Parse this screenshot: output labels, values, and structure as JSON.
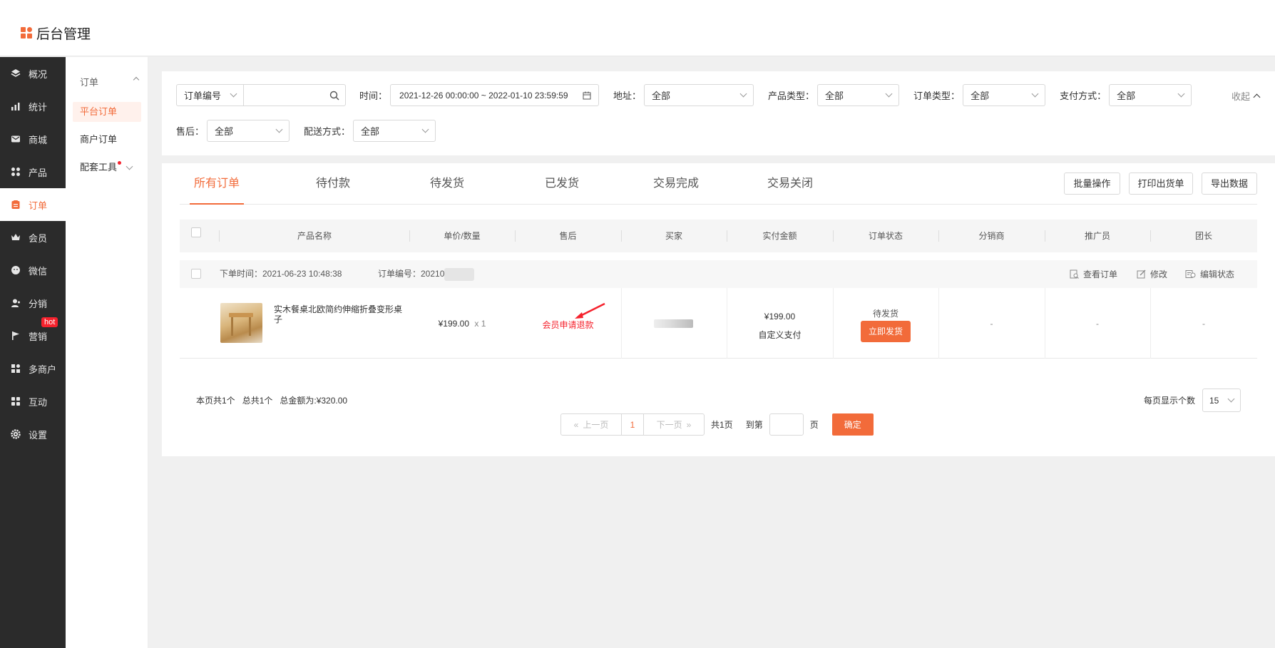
{
  "app": {
    "title": "后台管理"
  },
  "sidebar": {
    "items": [
      {
        "label": "概况",
        "icon": "layers-icon"
      },
      {
        "label": "统计",
        "icon": "chart-icon"
      },
      {
        "label": "商城",
        "icon": "mail-icon"
      },
      {
        "label": "产品",
        "icon": "grid-icon"
      },
      {
        "label": "订单",
        "icon": "order-icon",
        "active": true
      },
      {
        "label": "会员",
        "icon": "crown-icon"
      },
      {
        "label": "微信",
        "icon": "wechat-icon"
      },
      {
        "label": "分销",
        "icon": "user-icon"
      },
      {
        "label": "营销",
        "icon": "flag-icon",
        "badge": "hot"
      },
      {
        "label": "多商户",
        "icon": "store-icon"
      },
      {
        "label": "互动",
        "icon": "apps-icon"
      },
      {
        "label": "设置",
        "icon": "gear-icon"
      }
    ]
  },
  "subnav": {
    "header": "订单",
    "items": [
      "平台订单",
      "商户订单",
      "配套工具"
    ]
  },
  "filters": {
    "search_type": "订单编号",
    "search_placeholder": "",
    "time_label": "时间：",
    "time_value": "2021-12-26 00:00:00 ~ 2022-01-10 23:59:59",
    "address_label": "地址：",
    "address_value": "全部",
    "product_type_label": "产品类型：",
    "product_type_value": "全部",
    "order_type_label": "订单类型：",
    "order_type_value": "全部",
    "payment_label": "支付方式：",
    "payment_value": "全部",
    "collapse_label": "收起",
    "after_sale_label": "售后：",
    "after_sale_value": "全部",
    "delivery_label": "配送方式：",
    "delivery_value": "全部"
  },
  "tabs": [
    "所有订单",
    "待付款",
    "待发货",
    "已发货",
    "交易完成",
    "交易关闭"
  ],
  "actions": {
    "batch": "批量操作",
    "print": "打印出货单",
    "export": "导出数据"
  },
  "table": {
    "columns": [
      "产品名称",
      "单价/数量",
      "售后",
      "买家",
      "实付金额",
      "订单状态",
      "分销商",
      "推广员",
      "团长"
    ]
  },
  "order": {
    "time": "下单时间：2021-06-23 10:48:38",
    "number": "订单编号：20210",
    "view": "查看订单",
    "edit": "修改",
    "edit_status": "编辑状态",
    "product_name": "实木餐桌北欧简约伸缩折叠变形桌子",
    "price": "¥199.00",
    "qty": "x 1",
    "after_sale": "会员申请退款",
    "paid": "¥199.00",
    "pay_method": "自定义支付",
    "status": "待发货",
    "ship_button": "立即发货",
    "distributor": "-",
    "promoter": "-",
    "leader": "-"
  },
  "summary": {
    "page_count": "本页共1个",
    "total_count": "总共1个",
    "total_amount": "总金额为:¥320.00"
  },
  "pagination": {
    "prev": "上一页",
    "current": "1",
    "next": "下一页",
    "total_pages": "共1页",
    "goto_label": "到第",
    "page_suffix": "页",
    "confirm": "确定",
    "page_size_label": "每页显示个数",
    "page_size": "15"
  },
  "colors": {
    "accent": "#f26b3a",
    "sidebar_bg": "#2b2b2b",
    "alert": "#f5222d"
  }
}
